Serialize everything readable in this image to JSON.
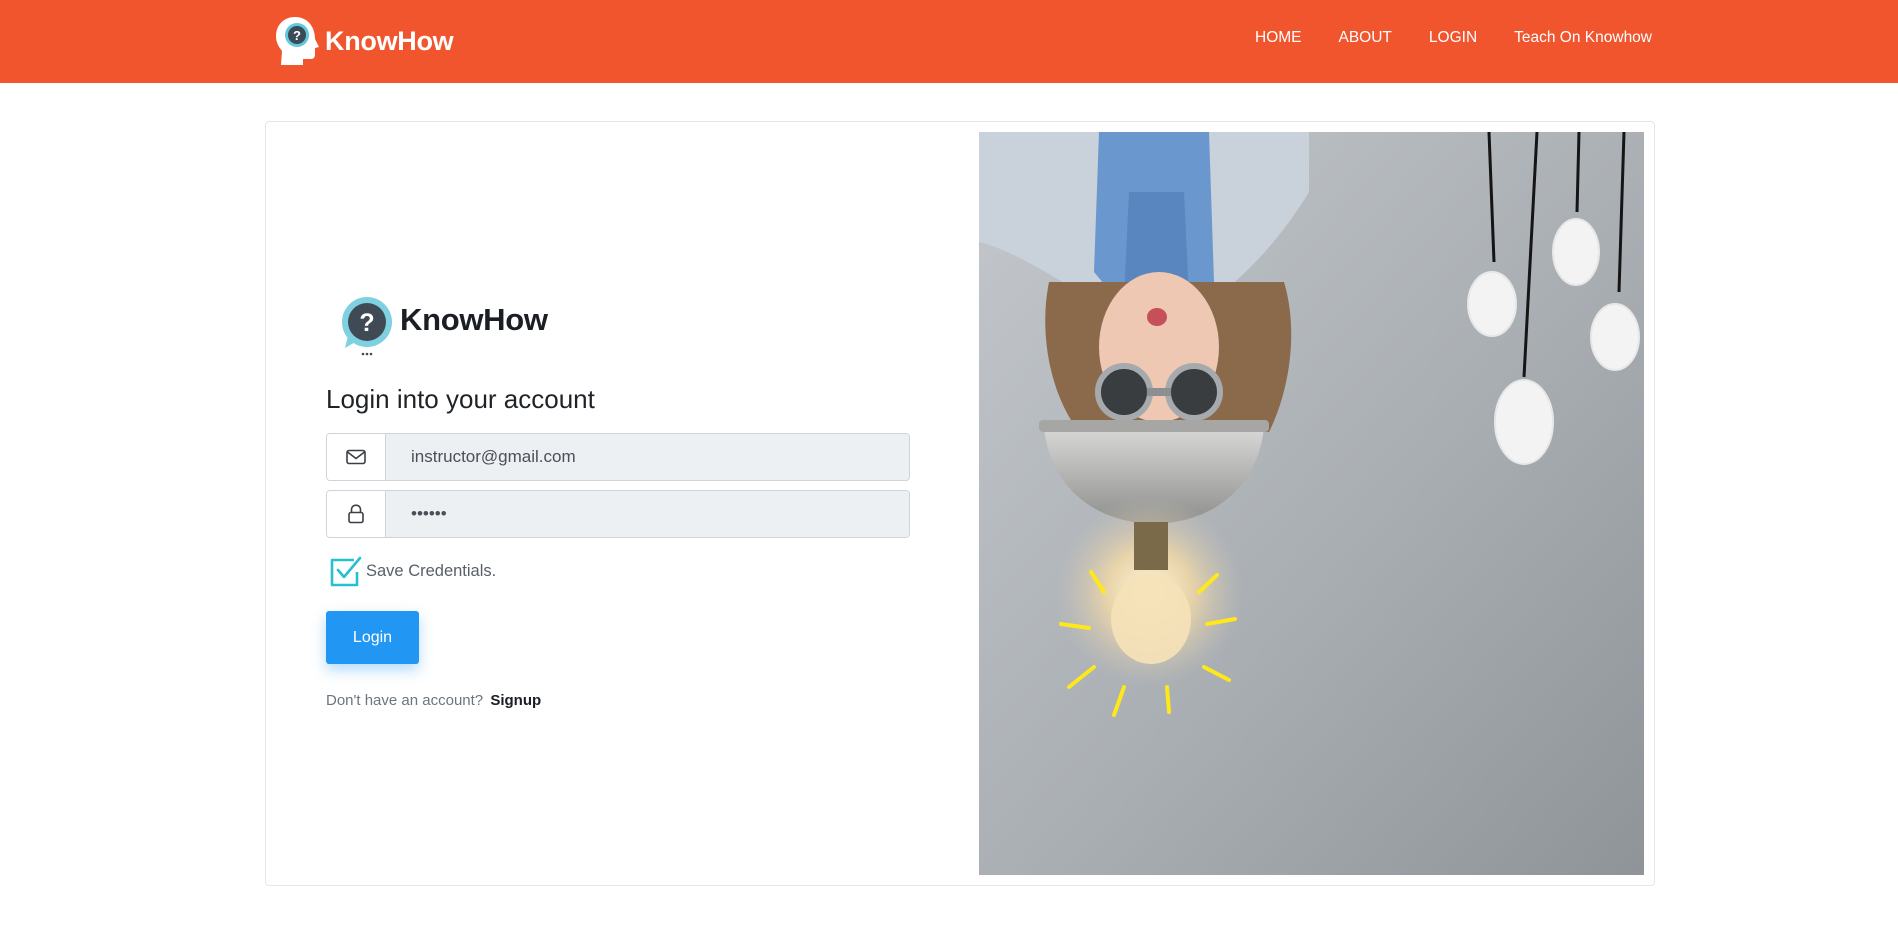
{
  "brand": {
    "name": "KnowHow"
  },
  "nav": {
    "items": [
      {
        "label": "HOME"
      },
      {
        "label": "ABOUT"
      },
      {
        "label": "LOGIN"
      },
      {
        "label": "Teach On Knowhow"
      }
    ]
  },
  "login_form": {
    "logo_text": "KnowHow",
    "title": "Login into your account",
    "email": {
      "value": "instructor@gmail.com",
      "icon": "envelope-icon"
    },
    "password": {
      "value": "123456",
      "icon": "lock-icon"
    },
    "remember": {
      "label": "Save Credentials.",
      "checked": true
    },
    "submit_label": "Login",
    "signup_prompt": "Don't have an account?",
    "signup_link": "Signup"
  },
  "colors": {
    "navbar": "#f0552e",
    "primary_button": "#2196f3",
    "checkbox": "#26c0cf"
  }
}
